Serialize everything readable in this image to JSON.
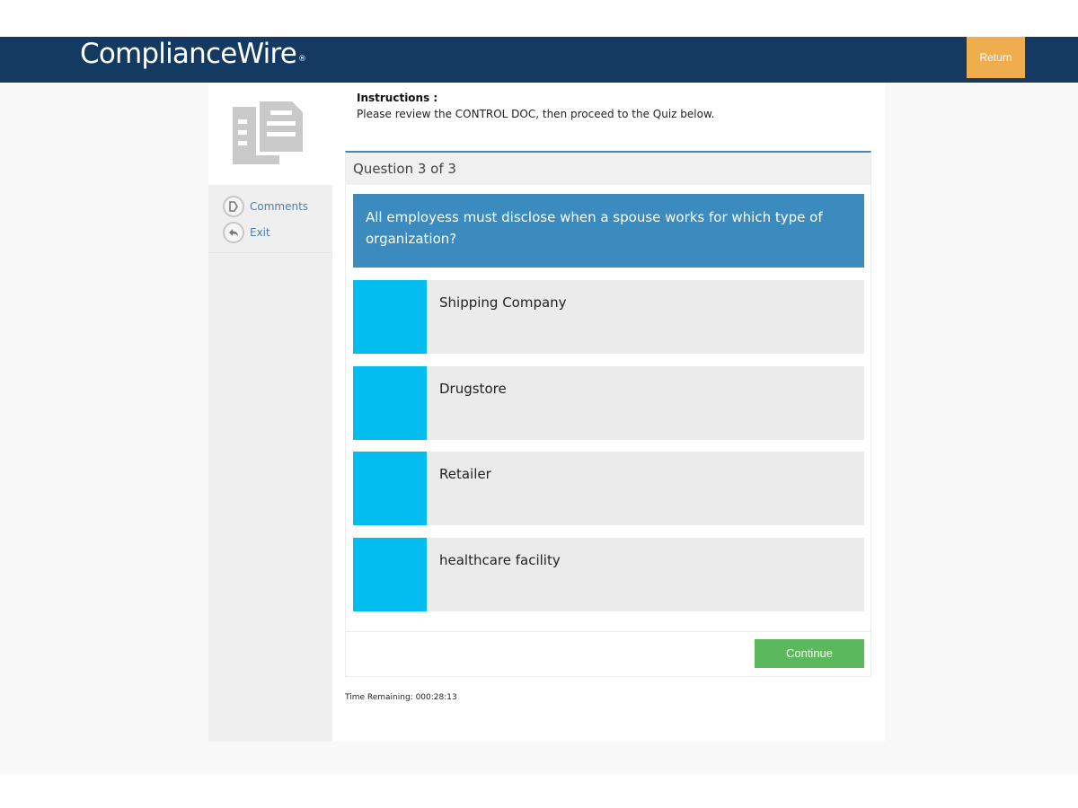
{
  "header": {
    "logo_text": "ComplianceWire",
    "logo_mark": "®",
    "return_label": "Return"
  },
  "sidebar": {
    "items": [
      {
        "label": "Comments",
        "icon": "play-circle-icon"
      },
      {
        "label": "Exit",
        "icon": "reply-arrow-icon"
      }
    ]
  },
  "instructions": {
    "title": "Instructions :",
    "text": "Please review the CONTROL DOC, then proceed to the Quiz below."
  },
  "quiz": {
    "header": "Question 3 of 3",
    "question": "All employess must disclose when a spouse works for which type of organization?",
    "answers": [
      "Shipping Company",
      "Drugstore",
      "Retailer",
      "healthcare facility"
    ],
    "continue_label": "Continue"
  },
  "timer": "Time Remaining: 000:28:13",
  "colors": {
    "header_bg": "#143a61",
    "return_bg": "#f0ad4e",
    "question_bg": "#3b8bbe",
    "answer_marker": "#00bcef",
    "continue_bg": "#5cb85c"
  }
}
